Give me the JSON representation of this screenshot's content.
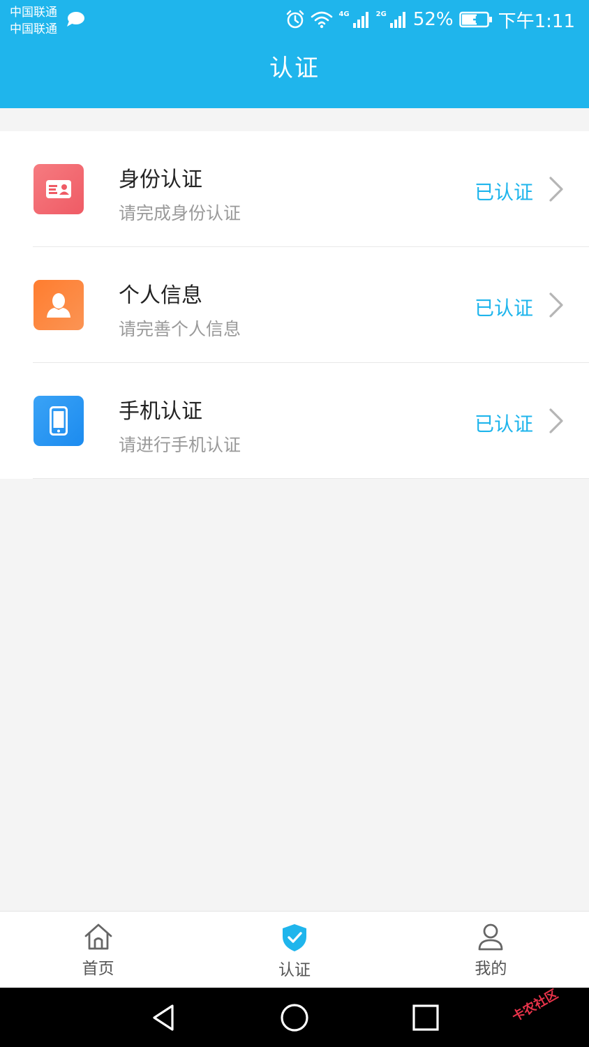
{
  "status_bar": {
    "carrier_1": "中国联通",
    "carrier_2": "中国联通",
    "net_1": "4G",
    "net_2": "2G",
    "battery": "52%",
    "time": "下午1:11"
  },
  "header": {
    "title": "认证"
  },
  "items": [
    {
      "title": "身份认证",
      "subtitle": "请完成身份认证",
      "status": "已认证",
      "icon": "id-card-icon"
    },
    {
      "title": "个人信息",
      "subtitle": "请完善个人信息",
      "status": "已认证",
      "icon": "person-icon"
    },
    {
      "title": "手机认证",
      "subtitle": "请进行手机认证",
      "status": "已认证",
      "icon": "phone-icon"
    }
  ],
  "bottom_nav": {
    "home": "首页",
    "verify": "认证",
    "mine": "我的"
  },
  "colors": {
    "brand": "#1fb5ec",
    "id_icon": "#f0636c",
    "person_icon": "#fd8540",
    "phone_icon": "#2b95f2"
  },
  "watermark": "卡农社区"
}
